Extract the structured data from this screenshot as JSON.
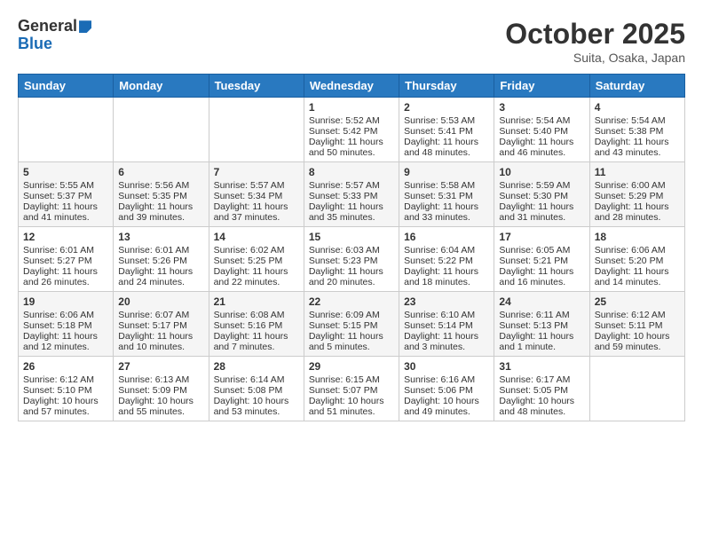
{
  "header": {
    "logo_general": "General",
    "logo_blue": "Blue",
    "month_title": "October 2025",
    "location": "Suita, Osaka, Japan"
  },
  "days_of_week": [
    "Sunday",
    "Monday",
    "Tuesday",
    "Wednesday",
    "Thursday",
    "Friday",
    "Saturday"
  ],
  "weeks": [
    [
      {
        "day": "",
        "sunrise": "",
        "sunset": "",
        "daylight": ""
      },
      {
        "day": "",
        "sunrise": "",
        "sunset": "",
        "daylight": ""
      },
      {
        "day": "",
        "sunrise": "",
        "sunset": "",
        "daylight": ""
      },
      {
        "day": "1",
        "sunrise": "Sunrise: 5:52 AM",
        "sunset": "Sunset: 5:42 PM",
        "daylight": "Daylight: 11 hours and 50 minutes."
      },
      {
        "day": "2",
        "sunrise": "Sunrise: 5:53 AM",
        "sunset": "Sunset: 5:41 PM",
        "daylight": "Daylight: 11 hours and 48 minutes."
      },
      {
        "day": "3",
        "sunrise": "Sunrise: 5:54 AM",
        "sunset": "Sunset: 5:40 PM",
        "daylight": "Daylight: 11 hours and 46 minutes."
      },
      {
        "day": "4",
        "sunrise": "Sunrise: 5:54 AM",
        "sunset": "Sunset: 5:38 PM",
        "daylight": "Daylight: 11 hours and 43 minutes."
      }
    ],
    [
      {
        "day": "5",
        "sunrise": "Sunrise: 5:55 AM",
        "sunset": "Sunset: 5:37 PM",
        "daylight": "Daylight: 11 hours and 41 minutes."
      },
      {
        "day": "6",
        "sunrise": "Sunrise: 5:56 AM",
        "sunset": "Sunset: 5:35 PM",
        "daylight": "Daylight: 11 hours and 39 minutes."
      },
      {
        "day": "7",
        "sunrise": "Sunrise: 5:57 AM",
        "sunset": "Sunset: 5:34 PM",
        "daylight": "Daylight: 11 hours and 37 minutes."
      },
      {
        "day": "8",
        "sunrise": "Sunrise: 5:57 AM",
        "sunset": "Sunset: 5:33 PM",
        "daylight": "Daylight: 11 hours and 35 minutes."
      },
      {
        "day": "9",
        "sunrise": "Sunrise: 5:58 AM",
        "sunset": "Sunset: 5:31 PM",
        "daylight": "Daylight: 11 hours and 33 minutes."
      },
      {
        "day": "10",
        "sunrise": "Sunrise: 5:59 AM",
        "sunset": "Sunset: 5:30 PM",
        "daylight": "Daylight: 11 hours and 31 minutes."
      },
      {
        "day": "11",
        "sunrise": "Sunrise: 6:00 AM",
        "sunset": "Sunset: 5:29 PM",
        "daylight": "Daylight: 11 hours and 28 minutes."
      }
    ],
    [
      {
        "day": "12",
        "sunrise": "Sunrise: 6:01 AM",
        "sunset": "Sunset: 5:27 PM",
        "daylight": "Daylight: 11 hours and 26 minutes."
      },
      {
        "day": "13",
        "sunrise": "Sunrise: 6:01 AM",
        "sunset": "Sunset: 5:26 PM",
        "daylight": "Daylight: 11 hours and 24 minutes."
      },
      {
        "day": "14",
        "sunrise": "Sunrise: 6:02 AM",
        "sunset": "Sunset: 5:25 PM",
        "daylight": "Daylight: 11 hours and 22 minutes."
      },
      {
        "day": "15",
        "sunrise": "Sunrise: 6:03 AM",
        "sunset": "Sunset: 5:23 PM",
        "daylight": "Daylight: 11 hours and 20 minutes."
      },
      {
        "day": "16",
        "sunrise": "Sunrise: 6:04 AM",
        "sunset": "Sunset: 5:22 PM",
        "daylight": "Daylight: 11 hours and 18 minutes."
      },
      {
        "day": "17",
        "sunrise": "Sunrise: 6:05 AM",
        "sunset": "Sunset: 5:21 PM",
        "daylight": "Daylight: 11 hours and 16 minutes."
      },
      {
        "day": "18",
        "sunrise": "Sunrise: 6:06 AM",
        "sunset": "Sunset: 5:20 PM",
        "daylight": "Daylight: 11 hours and 14 minutes."
      }
    ],
    [
      {
        "day": "19",
        "sunrise": "Sunrise: 6:06 AM",
        "sunset": "Sunset: 5:18 PM",
        "daylight": "Daylight: 11 hours and 12 minutes."
      },
      {
        "day": "20",
        "sunrise": "Sunrise: 6:07 AM",
        "sunset": "Sunset: 5:17 PM",
        "daylight": "Daylight: 11 hours and 10 minutes."
      },
      {
        "day": "21",
        "sunrise": "Sunrise: 6:08 AM",
        "sunset": "Sunset: 5:16 PM",
        "daylight": "Daylight: 11 hours and 7 minutes."
      },
      {
        "day": "22",
        "sunrise": "Sunrise: 6:09 AM",
        "sunset": "Sunset: 5:15 PM",
        "daylight": "Daylight: 11 hours and 5 minutes."
      },
      {
        "day": "23",
        "sunrise": "Sunrise: 6:10 AM",
        "sunset": "Sunset: 5:14 PM",
        "daylight": "Daylight: 11 hours and 3 minutes."
      },
      {
        "day": "24",
        "sunrise": "Sunrise: 6:11 AM",
        "sunset": "Sunset: 5:13 PM",
        "daylight": "Daylight: 11 hours and 1 minute."
      },
      {
        "day": "25",
        "sunrise": "Sunrise: 6:12 AM",
        "sunset": "Sunset: 5:11 PM",
        "daylight": "Daylight: 10 hours and 59 minutes."
      }
    ],
    [
      {
        "day": "26",
        "sunrise": "Sunrise: 6:12 AM",
        "sunset": "Sunset: 5:10 PM",
        "daylight": "Daylight: 10 hours and 57 minutes."
      },
      {
        "day": "27",
        "sunrise": "Sunrise: 6:13 AM",
        "sunset": "Sunset: 5:09 PM",
        "daylight": "Daylight: 10 hours and 55 minutes."
      },
      {
        "day": "28",
        "sunrise": "Sunrise: 6:14 AM",
        "sunset": "Sunset: 5:08 PM",
        "daylight": "Daylight: 10 hours and 53 minutes."
      },
      {
        "day": "29",
        "sunrise": "Sunrise: 6:15 AM",
        "sunset": "Sunset: 5:07 PM",
        "daylight": "Daylight: 10 hours and 51 minutes."
      },
      {
        "day": "30",
        "sunrise": "Sunrise: 6:16 AM",
        "sunset": "Sunset: 5:06 PM",
        "daylight": "Daylight: 10 hours and 49 minutes."
      },
      {
        "day": "31",
        "sunrise": "Sunrise: 6:17 AM",
        "sunset": "Sunset: 5:05 PM",
        "daylight": "Daylight: 10 hours and 48 minutes."
      },
      {
        "day": "",
        "sunrise": "",
        "sunset": "",
        "daylight": ""
      }
    ]
  ]
}
